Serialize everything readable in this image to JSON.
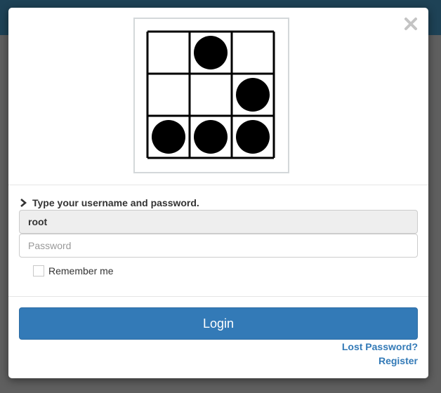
{
  "modal": {
    "close_icon": "close-x-icon",
    "logo_icon": "glider-logo-icon",
    "logo_grid": [
      [
        0,
        1,
        0
      ],
      [
        0,
        0,
        1
      ],
      [
        1,
        1,
        1
      ]
    ],
    "instruction": "Type your username and password.",
    "instruction_icon": "chevron-right-icon",
    "username_value": "root",
    "password_placeholder": "Password",
    "remember_label": "Remember me",
    "remember_checked": false,
    "login_label": "Login",
    "lost_password_label": "Lost Password?",
    "register_label": "Register"
  },
  "colors": {
    "primary": "#337ab7",
    "topbar": "#1e4256",
    "overlay": "#5f5f5f"
  }
}
